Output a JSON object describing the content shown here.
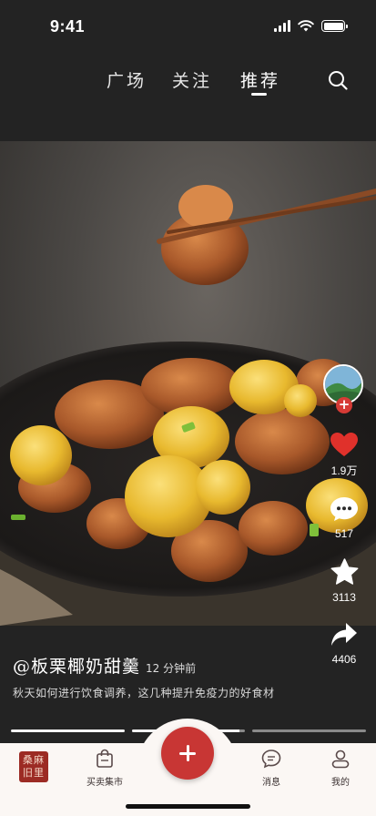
{
  "status_bar": {
    "time": "9:41"
  },
  "top_nav": {
    "tabs": [
      {
        "label": "广场",
        "active": false
      },
      {
        "label": "关注",
        "active": false
      },
      {
        "label": "推荐",
        "active": true
      }
    ],
    "search_icon": "search-icon"
  },
  "post": {
    "title": "@板栗椰奶甜羹",
    "time_ago": "12 分钟前",
    "description": "秋天如何进行饮食调养，这几种提升免疫力的好食材",
    "image_subject": "food-photo-chicken-chestnut"
  },
  "actions": {
    "likes": "1.9万",
    "comments": "517",
    "favorites": "3113",
    "shares": "4406"
  },
  "progress": {
    "segments": [
      1,
      0.95,
      0
    ],
    "active_index": 1
  },
  "bottom_nav": {
    "logo_text": "桑麻旧里",
    "items": [
      {
        "label": "买卖集市",
        "icon": "shopping-bag-icon"
      },
      {
        "label": "",
        "icon": "plus-icon"
      },
      {
        "label": "消息",
        "icon": "message-icon"
      },
      {
        "label": "我的",
        "icon": "profile-icon"
      }
    ]
  },
  "colors": {
    "accent": "#c83634",
    "like": "#e0312b",
    "background": "#232323",
    "bar": "#fbf7f4"
  }
}
